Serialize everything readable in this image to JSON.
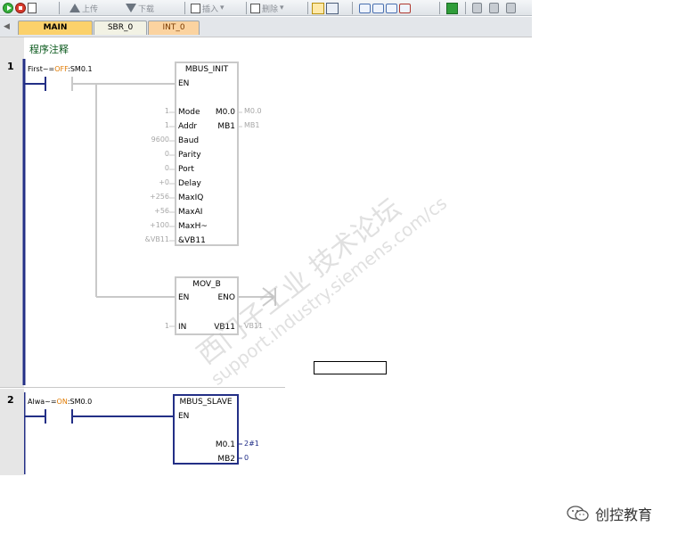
{
  "toolbar": {
    "upload_label": "上传",
    "download_label": "下载",
    "insert_label": "插入",
    "delete_label": "删除"
  },
  "tabs": [
    {
      "label": "MAIN",
      "active": true
    },
    {
      "label": "SBR_0",
      "active": false
    },
    {
      "label": "INT_0",
      "active": false
    }
  ],
  "program_comment": "程序注释",
  "network1": {
    "number": "1",
    "contact": {
      "name": "First~",
      "state": "OFF",
      "address": "SM0.1"
    },
    "mbus_init": {
      "title": "MBUS_INIT",
      "en": "EN",
      "inputs": [
        {
          "name": "Mode",
          "value": "1"
        },
        {
          "name": "Addr",
          "value": "1"
        },
        {
          "name": "Baud",
          "value": "9600"
        },
        {
          "name": "Parity",
          "value": "0"
        },
        {
          "name": "Port",
          "value": "0"
        },
        {
          "name": "Delay",
          "value": "+0"
        },
        {
          "name": "MaxIQ",
          "value": "+256"
        },
        {
          "name": "MaxAI",
          "value": "+56"
        },
        {
          "name": "MaxH~",
          "value": "+100"
        },
        {
          "name": "&VB11",
          "value": "&VB11"
        }
      ],
      "outputs": [
        {
          "name": "M0.0",
          "value": "M0.0"
        },
        {
          "name": "MB1",
          "value": "MB1"
        }
      ]
    },
    "mov_b": {
      "title": "MOV_B",
      "en": "EN",
      "eno": "ENO",
      "in_name": "IN",
      "in_value": "1",
      "out_name": "VB11",
      "out_value": "VB11"
    }
  },
  "network2": {
    "number": "2",
    "contact": {
      "name": "Alwa~",
      "state": "ON",
      "address": "SM0.0"
    },
    "mbus_slave": {
      "title": "MBUS_SLAVE",
      "en": "EN",
      "outputs": [
        {
          "name": "M0.1",
          "value": "2#1"
        },
        {
          "name": "MB2",
          "value": "0"
        }
      ]
    }
  },
  "watermark": {
    "line1": "西门子工业  技术论坛",
    "line2": "support.industry.siemens.com/cs"
  },
  "brand": {
    "text": "创控教育"
  },
  "colors": {
    "active_wire": "#232f86",
    "inactive_wire": "#c9c9c9",
    "status_orange": "#e07a00",
    "tab_main": "#fbd16b",
    "comment_green": "#0b5a1d"
  }
}
